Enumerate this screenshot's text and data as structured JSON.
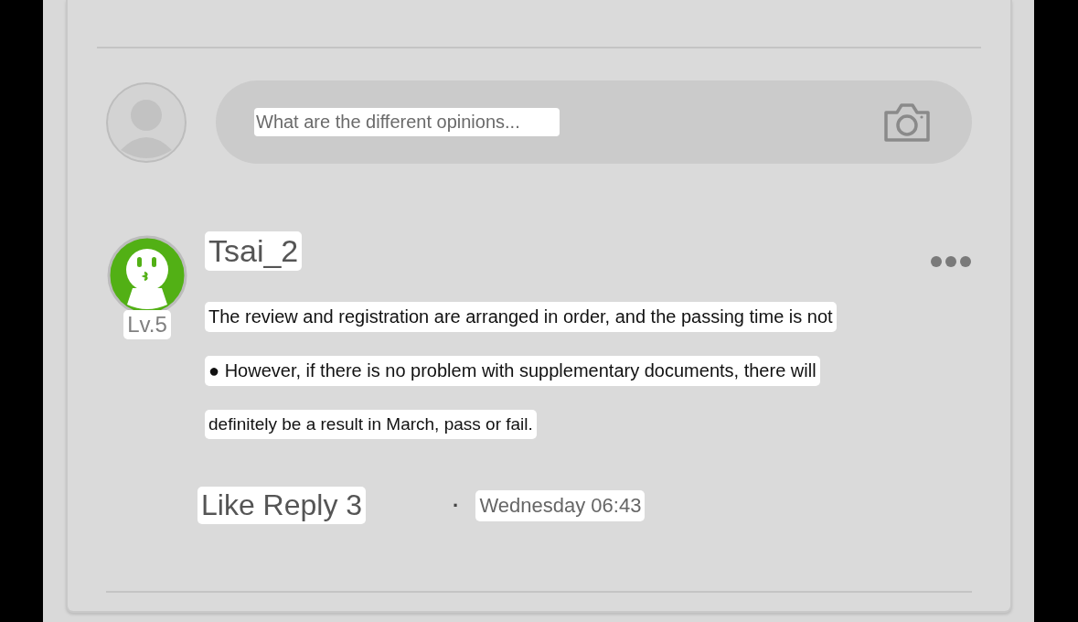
{
  "composer": {
    "placeholder": "What are the different opinions..."
  },
  "comment": {
    "username": "Tsai_2",
    "level_badge": "Lv.5",
    "paragraphs": [
      "The review and registration are arranged in order, and the passing time is not",
      "● However, if there is no problem with supplementary documents, there will",
      "definitely be a result in March, pass or fail."
    ],
    "actions": "Like Reply 3",
    "separator": "·",
    "timestamp": "Wednesday 06:43"
  }
}
